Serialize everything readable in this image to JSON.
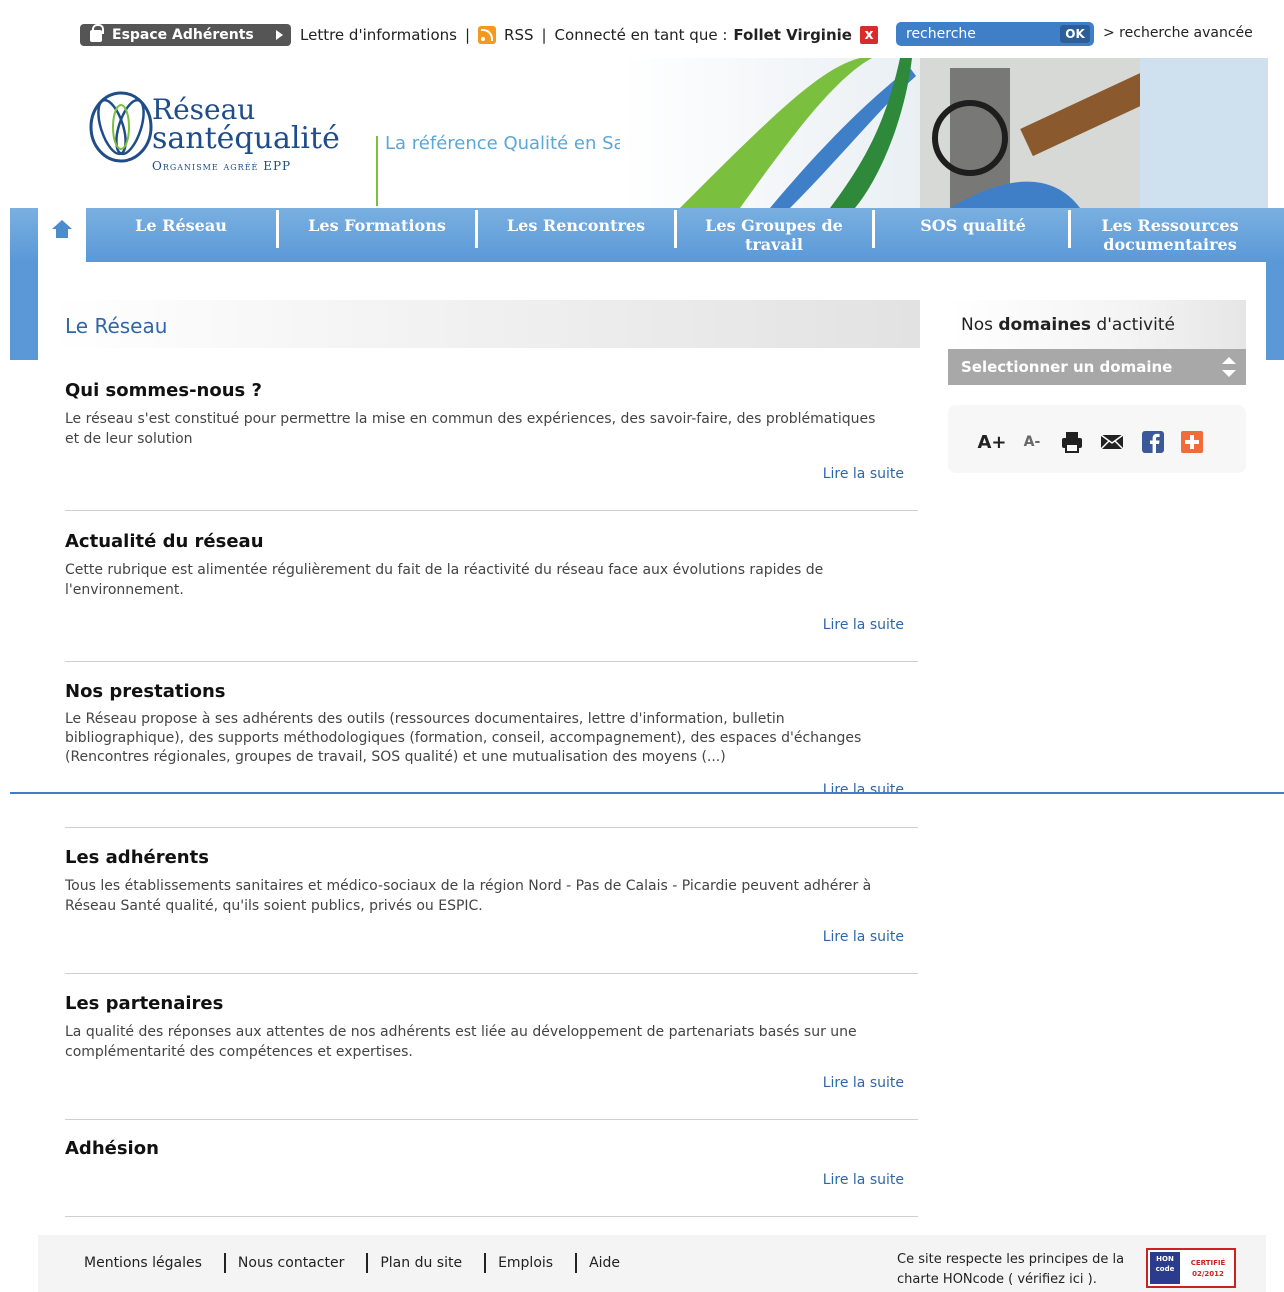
{
  "topbar": {
    "espace_label": "Espace Adhérents",
    "newsletter": "Lettre d'informations",
    "sep": "|",
    "rss": "RSS",
    "connected_label": "Connecté en tant que :",
    "user_name": "Follet Virginie",
    "close": "x",
    "search_placeholder": "recherche",
    "search_ok": "OK",
    "advanced_search": "> recherche avancée"
  },
  "header": {
    "logo_line1": "Réseau",
    "logo_line2": "santéqualité",
    "logo_line3": "Organisme agréé EPP",
    "tagline": "La référence Qualité en Santé"
  },
  "nav": {
    "items": [
      {
        "label": "Le Réseau"
      },
      {
        "label": "Les Formations"
      },
      {
        "label": "Les Rencontres"
      },
      {
        "label": "Les Groupes de travail"
      },
      {
        "label": "SOS qualité"
      },
      {
        "label": "Les Ressources documentaires"
      }
    ]
  },
  "main": {
    "page_title": "Le Réseau",
    "read_more": "Lire la suite",
    "sections": [
      {
        "title": "Qui sommes-nous ?",
        "text": "Le réseau s'est constitué pour permettre la mise en commun des expériences, des savoir-faire, des problématiques et de leur solution"
      },
      {
        "title": "Actualité du réseau",
        "text": "Cette rubrique est alimentée régulièrement du fait de la réactivité du réseau face aux évolutions rapides de l'environnement."
      },
      {
        "title": "Nos prestations",
        "text": "Le Réseau propose à ses adhérents des outils (ressources documentaires, lettre d'information, bulletin bibliographique), des supports méthodologiques (formation, conseil, accompagnement), des espaces d'échanges (Rencontres régionales, groupes de travail, SOS qualité) et une mutualisation des moyens (...)"
      },
      {
        "title": "Les adhérents",
        "text": "Tous les établissements sanitaires et médico-sociaux de la région Nord - Pas de Calais - Picardie peuvent adhérer à Réseau Santé qualité, qu'ils soient publics, privés ou ESPIC."
      },
      {
        "title": "Les partenaires",
        "text": "La qualité des réponses aux attentes de nos adhérents est liée au développement de partenariats basés sur une complémentarité des compétences et expertises."
      },
      {
        "title": "Adhésion",
        "text": ""
      }
    ]
  },
  "sidebar": {
    "domains_prefix": "Nos ",
    "domains_bold": "domaines",
    "domains_suffix": " d'activité",
    "select_label": "Selectionner un domaine",
    "tools": {
      "font_up": "A+",
      "font_down": "A-"
    }
  },
  "footer": {
    "links": [
      "Mentions légales",
      "Nous contacter",
      "Plan du site",
      "Emplois",
      "Aide"
    ],
    "hon_text": "Ce site respecte les principes de la charte HONcode ( vérifiez ici ).",
    "hon_badge": "HON code",
    "hon_cert": "CERTIFIÉ 02/2012"
  },
  "colors": {
    "nav_blue": "#5a98d8",
    "link_blue": "#2f66a8",
    "accent_green": "#7bbf3f"
  }
}
